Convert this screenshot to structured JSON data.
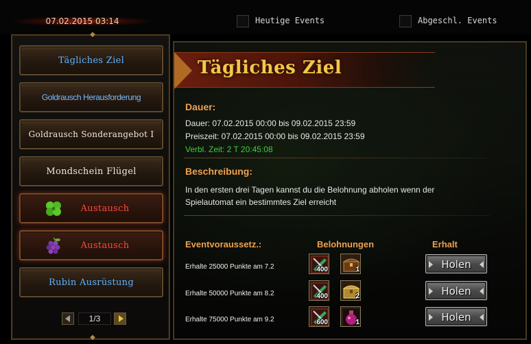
{
  "header": {
    "datetime": "07.02.2015 03:14",
    "checkbox_today": {
      "label": "Heutige Events",
      "checked": false
    },
    "checkbox_closed": {
      "label": "Abgeschl. Events",
      "checked": false
    }
  },
  "sidebar": {
    "items": [
      {
        "label": "Tägliches Ziel",
        "state": "active"
      },
      {
        "label": "Goldrausch Herausforderung",
        "state": "normal"
      },
      {
        "label": "Goldrausch Sonderangebot I",
        "state": "normal"
      },
      {
        "label": "Mondschein Flügel",
        "state": "normal"
      },
      {
        "label": "Austausch",
        "state": "highlight",
        "icon": "clover-icon"
      },
      {
        "label": "Austausch",
        "state": "highlight",
        "icon": "grapes-icon"
      },
      {
        "label": "Rubin Ausrüstung",
        "state": "normal"
      }
    ],
    "pager": {
      "text": "1/3"
    }
  },
  "main": {
    "title": "Tägliches Ziel",
    "duration_heading": "Dauer:",
    "duration_line": "Dauer: 07.02.2015 00:00 bis 09.02.2015 23:59",
    "prize_line": "Preiszeit: 07.02.2015 00:00 bis 09.02.2015 23:59",
    "remaining_line": "Verbl. Zeit: 2 T  20:45:08",
    "description_heading": "Beschreibung:",
    "description": "In den ersten drei Tagen kannst du die Belohnung abholen wenn der Spielautomat ein bestimmtes Ziel erreicht",
    "table": {
      "headers": {
        "condition": "Eventvoraussetz.:",
        "rewards": "Belohnungen",
        "claim": "Erhalt"
      },
      "rows": [
        {
          "condition": "Erhalte 25000 Punkte am 7.2",
          "reward1_qty": "400",
          "reward1_icon": "gem-card-icon",
          "reward2_qty": "1",
          "reward2_icon": "chest-icon",
          "button": "Holen"
        },
        {
          "condition": "Erhalte 50000 Punkte am 8.2",
          "reward1_qty": "400",
          "reward1_icon": "gem-card-icon",
          "reward2_qty": "2",
          "reward2_icon": "gold-chest-icon",
          "button": "Holen"
        },
        {
          "condition": "Erhalte 75000 Punkte am 9.2",
          "reward1_qty": "600",
          "reward1_icon": "gem-card-icon",
          "reward2_qty": "1",
          "reward2_icon": "potion-icon",
          "button": "Holen"
        }
      ]
    }
  },
  "colors": {
    "accent_orange": "#f0a050",
    "title_gold": "#f5c64a",
    "active_blue": "#5fb4ff",
    "highlight_red": "#ff4a3a",
    "remaining_green": "#3ccf3c"
  }
}
